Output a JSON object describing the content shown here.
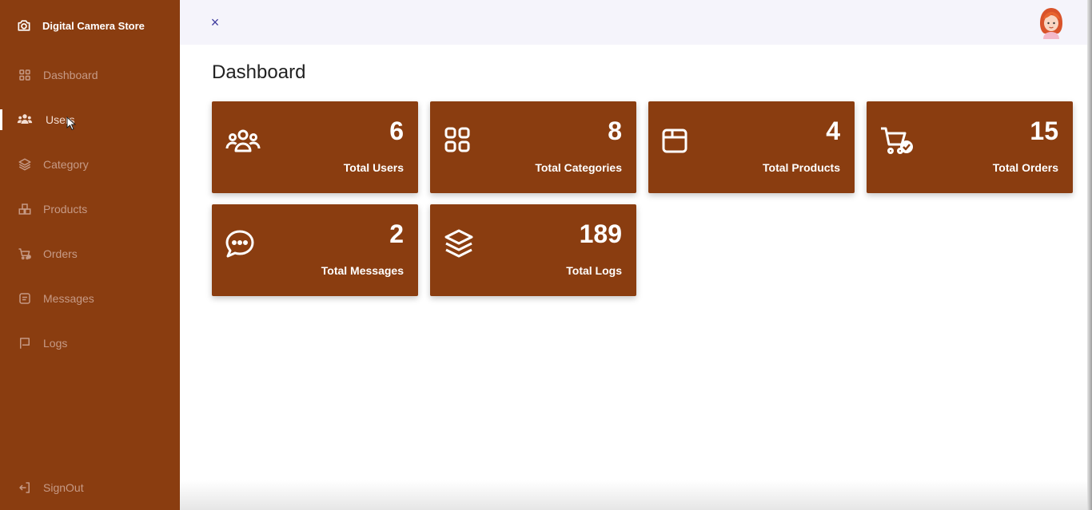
{
  "brand": {
    "name": "Digital Camera Store",
    "icon": "camera-icon"
  },
  "sidebar": {
    "items": [
      {
        "label": "Dashboard",
        "icon": "grid-icon",
        "active": false
      },
      {
        "label": "Users",
        "icon": "users-icon",
        "active": true
      },
      {
        "label": "Category",
        "icon": "layers-icon",
        "active": false
      },
      {
        "label": "Products",
        "icon": "boxes-icon",
        "active": false
      },
      {
        "label": "Orders",
        "icon": "cart-check-icon",
        "active": false
      },
      {
        "label": "Messages",
        "icon": "message-square-icon",
        "active": false
      },
      {
        "label": "Logs",
        "icon": "flag-icon",
        "active": false
      }
    ],
    "signout": {
      "label": "SignOut",
      "icon": "sign-out-icon"
    }
  },
  "topbar": {
    "close_icon": "×",
    "avatar": "user-avatar"
  },
  "page": {
    "title": "Dashboard"
  },
  "cards": [
    {
      "value": "6",
      "label": "Total Users",
      "icon": "users-icon"
    },
    {
      "value": "8",
      "label": "Total Categories",
      "icon": "grid-icon"
    },
    {
      "value": "4",
      "label": "Total Products",
      "icon": "box-icon"
    },
    {
      "value": "15",
      "label": "Total Orders",
      "icon": "cart-check-icon"
    },
    {
      "value": "2",
      "label": "Total Messages",
      "icon": "chat-icon"
    },
    {
      "value": "189",
      "label": "Total Logs",
      "icon": "layers-icon"
    }
  ],
  "colors": {
    "accent": "#8a3d10",
    "sidebar_text": "#c69a86",
    "topbar_bg": "#f5f4fb",
    "close_icon": "#3e3b9e"
  }
}
